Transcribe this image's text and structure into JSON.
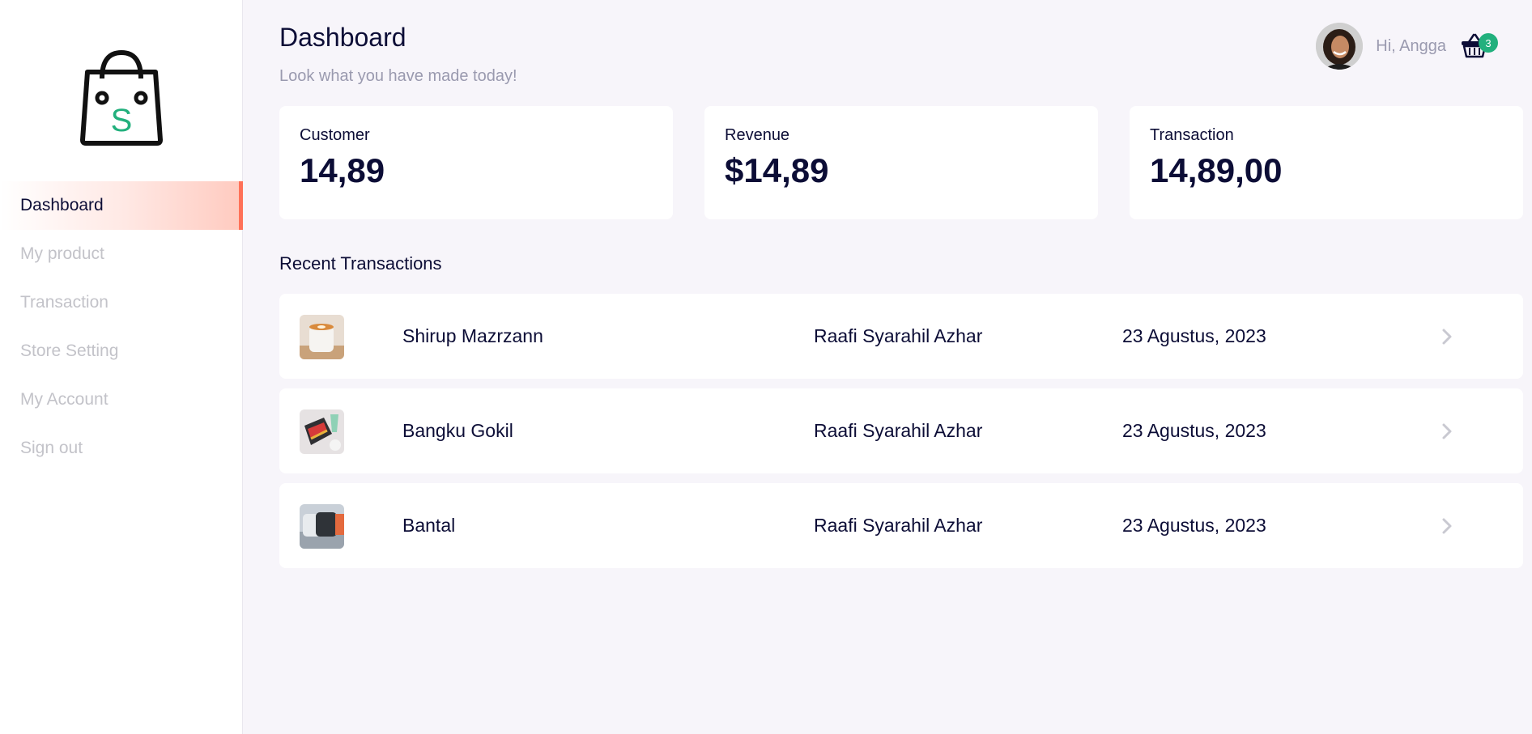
{
  "sidebar": {
    "logo_letter": "S",
    "items": [
      {
        "label": "Dashboard",
        "active": true
      },
      {
        "label": "My product",
        "active": false
      },
      {
        "label": "Transaction",
        "active": false
      },
      {
        "label": "Store Setting",
        "active": false
      },
      {
        "label": "My Account",
        "active": false
      },
      {
        "label": "Sign out",
        "active": false
      }
    ]
  },
  "header": {
    "title": "Dashboard",
    "subtitle": "Look what you have made today!",
    "greeting": "Hi, Angga",
    "cart_count": "3"
  },
  "stats": [
    {
      "label": "Customer",
      "value": "14,89"
    },
    {
      "label": "Revenue",
      "value": "$14,89"
    },
    {
      "label": "Transaction",
      "value": "14,89,00"
    }
  ],
  "recent": {
    "title": "Recent Transactions",
    "rows": [
      {
        "product": "Shirup Mazrzann",
        "customer": "Raafi Syarahil Azhar",
        "date": "23 Agustus, 2023",
        "thumb_icon": "coffee-cup-thumbnail"
      },
      {
        "product": "Bangku Gokil",
        "customer": "Raafi Syarahil Azhar",
        "date": "23 Agustus, 2023",
        "thumb_icon": "chair-thumbnail"
      },
      {
        "product": "Bantal",
        "customer": "Raafi Syarahil Azhar",
        "date": "23 Agustus, 2023",
        "thumb_icon": "pillow-thumbnail"
      }
    ]
  },
  "colors": {
    "accent": "#ff7158",
    "brand_green": "#22b07d",
    "text_dark": "#0c0d36",
    "text_muted": "#9a9aaf",
    "background": "#f7f5fa"
  }
}
